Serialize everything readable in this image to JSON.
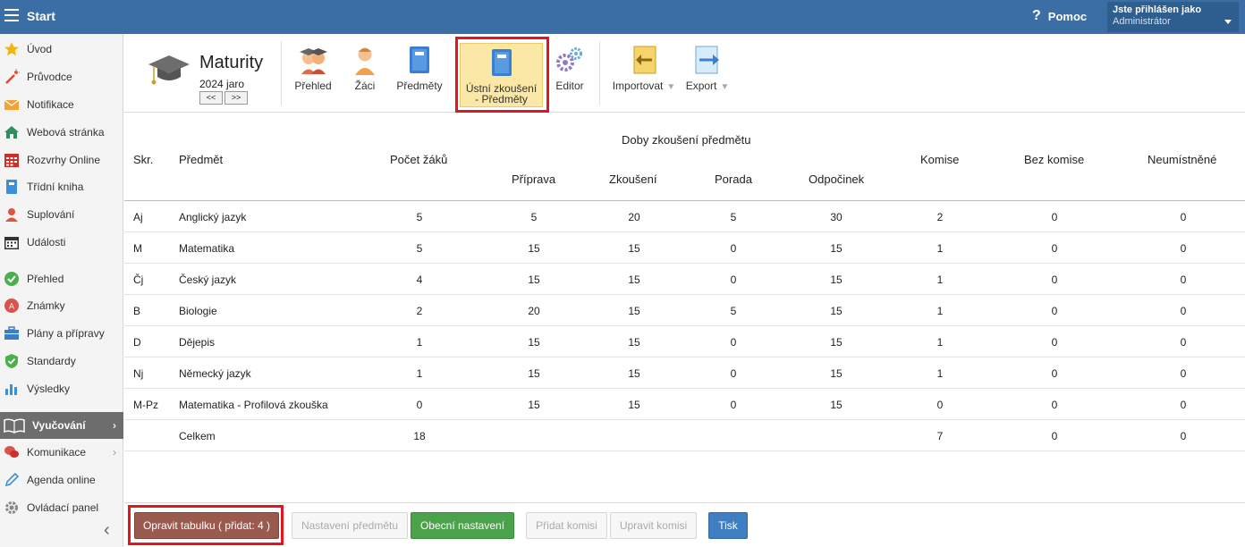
{
  "topbar": {
    "title": "Start",
    "help_label": "Pomoc",
    "user_line1": "Jste přihlášen jako",
    "user_line2": "Administrátor"
  },
  "sidebar": {
    "items": [
      {
        "label": "Úvod",
        "icon": "star-icon"
      },
      {
        "label": "Průvodce",
        "icon": "wand-icon"
      },
      {
        "label": "Notifikace",
        "icon": "envelope-icon"
      },
      {
        "label": "Webová stránka",
        "icon": "home-icon"
      },
      {
        "label": "Rozvrhy Online",
        "icon": "calendar-grid-icon"
      },
      {
        "label": "Třídní kniha",
        "icon": "book-icon"
      },
      {
        "label": "Suplování",
        "icon": "person-icon"
      },
      {
        "label": "Události",
        "icon": "calendar-icon"
      },
      {
        "label": "Přehled",
        "icon": "check-circle-icon"
      },
      {
        "label": "Známky",
        "icon": "grade-icon"
      },
      {
        "label": "Plány a přípravy",
        "icon": "briefcase-icon"
      },
      {
        "label": "Standardy",
        "icon": "shield-check-icon"
      },
      {
        "label": "Výsledky",
        "icon": "bar-chart-icon"
      },
      {
        "label": "Vyučování",
        "icon": "open-book-icon"
      },
      {
        "label": "Komunikace",
        "icon": "chat-icon"
      },
      {
        "label": "Agenda online",
        "icon": "pen-icon"
      },
      {
        "label": "Ovládací panel",
        "icon": "gear-icon"
      }
    ]
  },
  "ribbon": {
    "title": "Maturity",
    "term": "2024 jaro",
    "prev": "<<",
    "next": ">>",
    "buttons": {
      "prehled": "Přehled",
      "zaci": "Žáci",
      "predmety": "Předměty",
      "ustni_1": "Ústní zkoušení",
      "ustni_2": "- Předměty",
      "editor": "Editor",
      "importovat": "Importovat",
      "export": "Export"
    }
  },
  "table": {
    "group_header": "Doby zkoušení předmětu",
    "headers": {
      "skr": "Skr.",
      "predmet": "Předmět",
      "pocet": "Počet žáků",
      "priprava": "Příprava",
      "zkouseni": "Zkoušení",
      "porada": "Porada",
      "odpocinek": "Odpočinek",
      "komise": "Komise",
      "bez_komise": "Bez komise",
      "neumistene": "Neumístněné"
    },
    "rows": [
      {
        "skr": "Aj",
        "predmet": "Anglický jazyk",
        "pocet": "5",
        "priprava": "5",
        "zkouseni": "20",
        "porada": "5",
        "odpocinek": "30",
        "komise": "2",
        "bez": "0",
        "neum": "0"
      },
      {
        "skr": "M",
        "predmet": "Matematika",
        "pocet": "5",
        "priprava": "15",
        "zkouseni": "15",
        "porada": "0",
        "odpocinek": "15",
        "komise": "1",
        "bez": "0",
        "neum": "0"
      },
      {
        "skr": "Čj",
        "predmet": "Český jazyk",
        "pocet": "4",
        "priprava": "15",
        "zkouseni": "15",
        "porada": "0",
        "odpocinek": "15",
        "komise": "1",
        "bez": "0",
        "neum": "0"
      },
      {
        "skr": "B",
        "predmet": "Biologie",
        "pocet": "2",
        "priprava": "20",
        "zkouseni": "15",
        "porada": "5",
        "odpocinek": "15",
        "komise": "1",
        "bez": "0",
        "neum": "0"
      },
      {
        "skr": "D",
        "predmet": "Dějepis",
        "pocet": "1",
        "priprava": "15",
        "zkouseni": "15",
        "porada": "0",
        "odpocinek": "15",
        "komise": "1",
        "bez": "0",
        "neum": "0"
      },
      {
        "skr": "Nj",
        "predmet": "Německý jazyk",
        "pocet": "1",
        "priprava": "15",
        "zkouseni": "15",
        "porada": "0",
        "odpocinek": "15",
        "komise": "1",
        "bez": "0",
        "neum": "0"
      },
      {
        "skr": "M-Pz",
        "predmet": "Matematika - Profilová zkouška",
        "pocet": "0",
        "priprava": "15",
        "zkouseni": "15",
        "porada": "0",
        "odpocinek": "15",
        "komise": "0",
        "bez": "0",
        "neum": "0"
      }
    ],
    "total": {
      "label": "Celkem",
      "pocet": "18",
      "komise": "7",
      "bez": "0",
      "neum": "0"
    }
  },
  "footer": {
    "opravit": "Opravit tabulku ( přidat: 4 )",
    "nastaveni_predmetu": "Nastavení předmětu",
    "obecni": "Obecní nastavení",
    "pridat_komisi": "Přidat komisi",
    "upravit_komisi": "Upravit komisi",
    "tisk": "Tisk"
  }
}
